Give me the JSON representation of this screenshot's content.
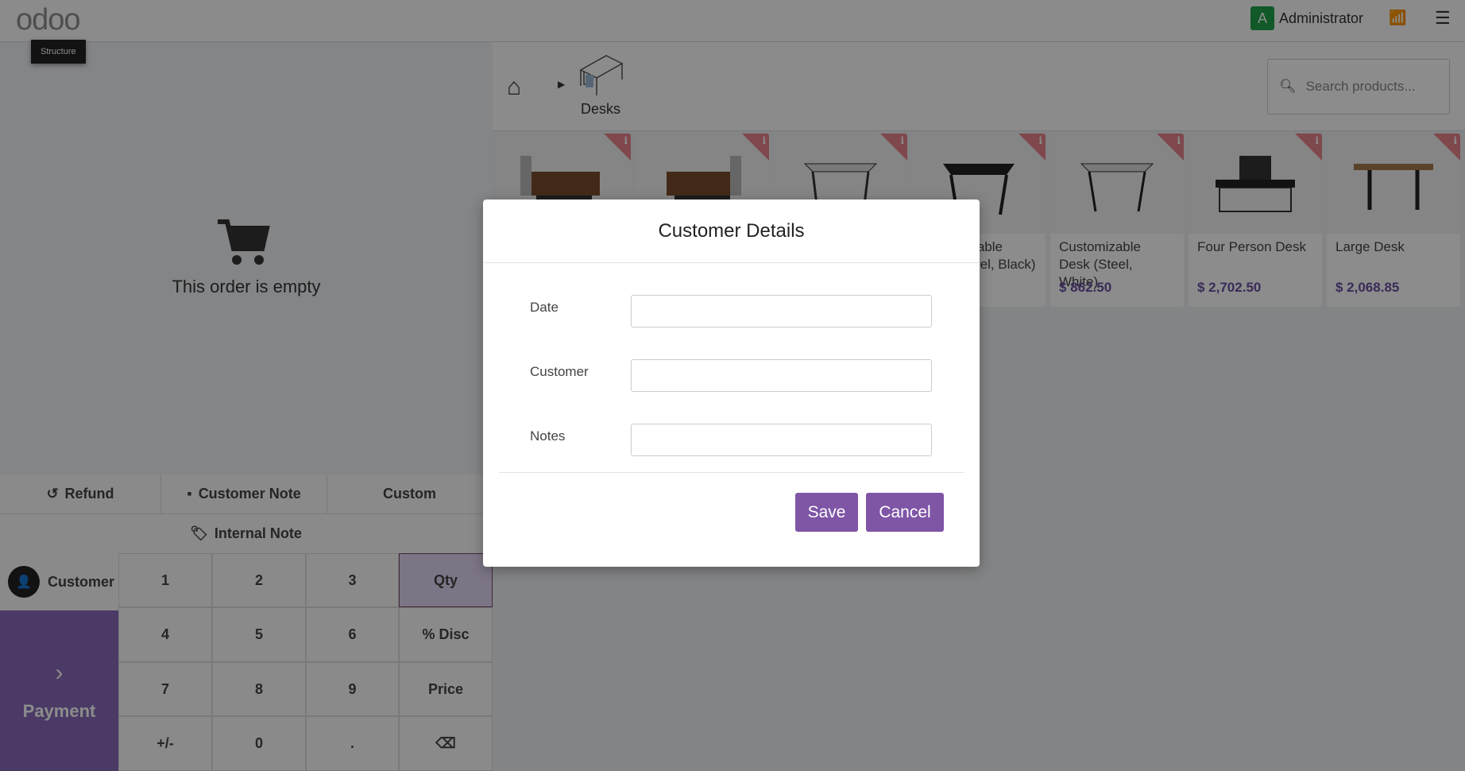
{
  "topbar": {
    "logo": "odoo",
    "tooltip": "Structure",
    "user_initial": "A",
    "user_name": "Administrator"
  },
  "order": {
    "empty_text": "This order is empty"
  },
  "controls": {
    "refund": "Refund",
    "customer_note": "Customer Note",
    "custom": "Custom",
    "internal_note": "Internal Note"
  },
  "numpad": {
    "customer": "Customer",
    "payment": "Payment",
    "keys": [
      "1",
      "2",
      "3",
      "Qty",
      "4",
      "5",
      "6",
      "% Disc",
      "7",
      "8",
      "9",
      "Price",
      "+/-",
      "0",
      ".",
      "⌫"
    ],
    "selected": "Qty"
  },
  "breadcrumb": {
    "category": "Desks"
  },
  "search": {
    "placeholder": "Search products..."
  },
  "products": [
    {
      "name": "",
      "price": ""
    },
    {
      "name": "",
      "price": ""
    },
    {
      "name": "",
      "price": ""
    },
    {
      "name": "Customizable Desk (Steel, Black)",
      "price": ""
    },
    {
      "name": "Customizable Desk (Steel, White)",
      "price": "$ 862.50"
    },
    {
      "name": "Four Person Desk",
      "price": "$ 2,702.50"
    },
    {
      "name": "Large Desk",
      "price": "$ 2,068.85"
    }
  ],
  "modal": {
    "title": "Customer Details",
    "fields": [
      {
        "label": "Date",
        "value": ""
      },
      {
        "label": "Customer",
        "value": ""
      },
      {
        "label": "Notes",
        "value": ""
      }
    ],
    "save": "Save",
    "cancel": "Cancel"
  },
  "colors": {
    "accent": "#7f55a6",
    "ribbon": "#e8838a",
    "status_online": "#27c24c"
  }
}
